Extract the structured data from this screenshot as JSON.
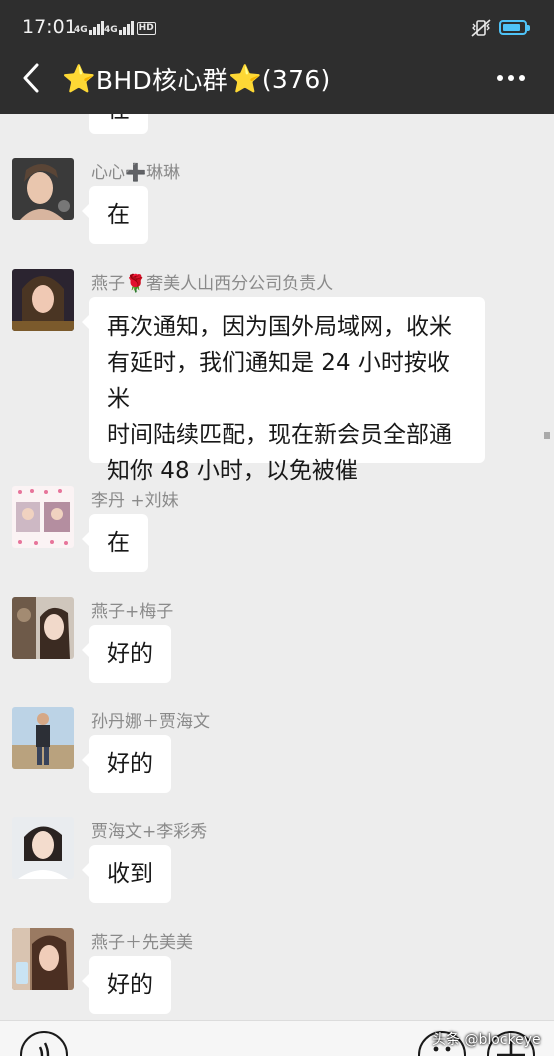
{
  "status_bar": {
    "time": "17:01",
    "net1": "4G",
    "net2": "4G",
    "hd": "HD",
    "battery_level": 0.85,
    "accent": "#4fc3f7"
  },
  "header": {
    "title_text": "BHD核心群",
    "member_count": "(376)",
    "star_glyph": "⭐",
    "back_icon": "chevron-left",
    "more_icon": "ellipsis"
  },
  "partial_message": {
    "text": "在"
  },
  "messages": [
    {
      "sender": "心心➕琳琳",
      "text": "在"
    },
    {
      "sender": "燕子🌹奢美人山西分公司负责人",
      "lines": [
        "再次通知，因为国外局域网，收米",
        "有延时，我们通知是 24 小时按收米",
        "时间陆续匹配，现在新会员全部通",
        "知你 48 小时，以免被催"
      ]
    },
    {
      "sender": "李丹 +刘妹",
      "text": "在"
    },
    {
      "sender": "燕子+梅子",
      "text": "好的"
    },
    {
      "sender": "孙丹娜＋贾海文",
      "text": "好的"
    },
    {
      "sender": "贾海文+李彩秀",
      "text": "收到"
    },
    {
      "sender": "燕子＋先美美",
      "text": "好的"
    }
  ],
  "bottom_bar": {
    "voice_icon": "voice",
    "emoji_icon": "emoji",
    "plus_icon": "plus",
    "watermark": "头条 @blockeye"
  }
}
